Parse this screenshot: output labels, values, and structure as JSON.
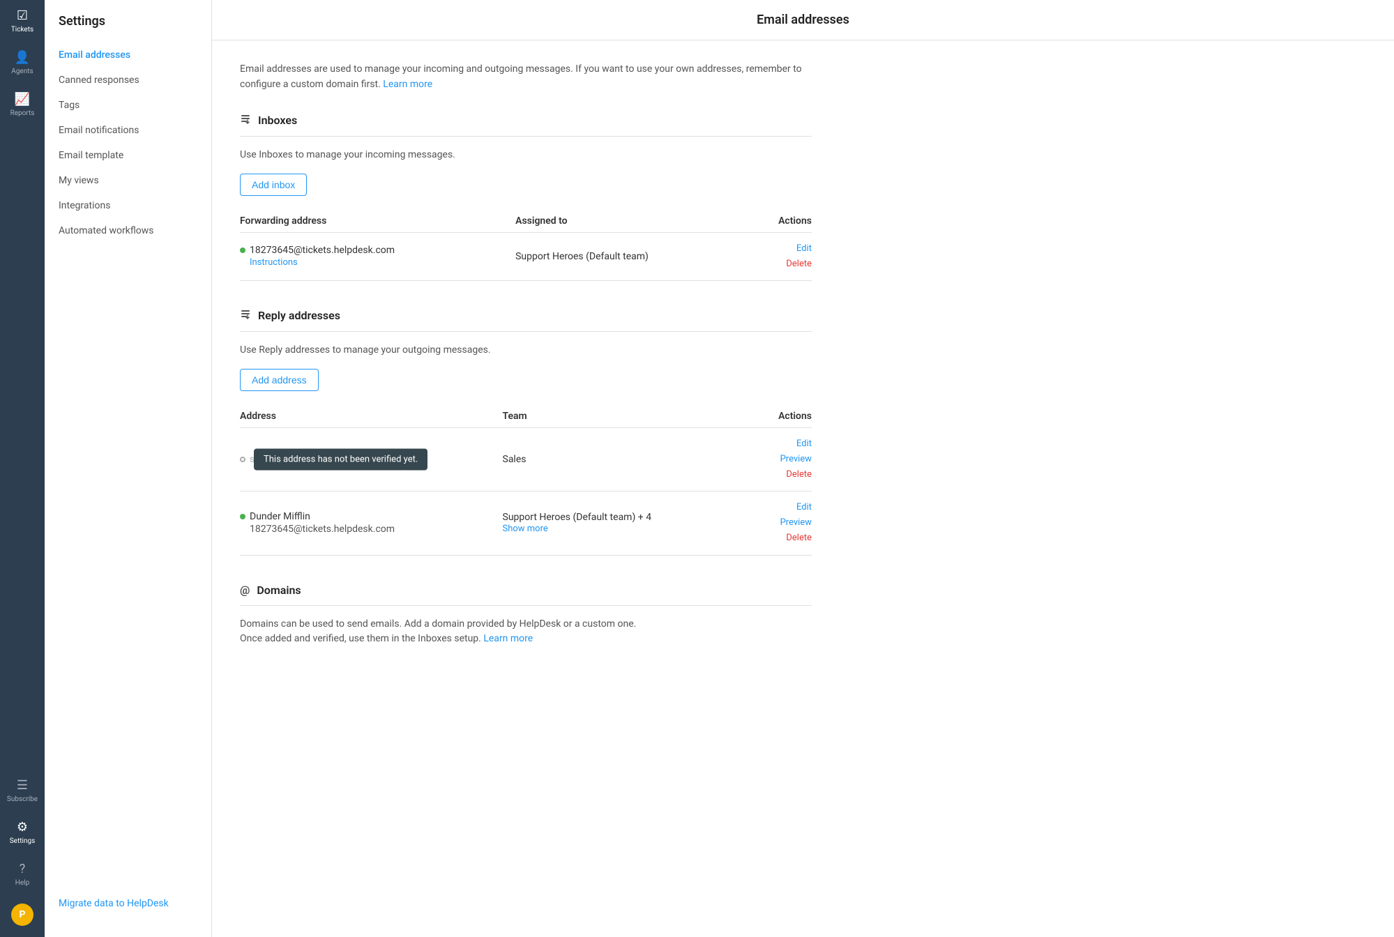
{
  "icon_nav": {
    "items": [
      {
        "id": "tickets",
        "label": "Tickets",
        "icon": "☑"
      },
      {
        "id": "agents",
        "label": "Agents",
        "icon": "👤"
      },
      {
        "id": "reports",
        "label": "Reports",
        "icon": "📈"
      }
    ],
    "bottom_items": [
      {
        "id": "subscribe",
        "label": "Subscribe",
        "icon": "☰"
      },
      {
        "id": "settings",
        "label": "Settings",
        "icon": "⚙"
      },
      {
        "id": "help",
        "label": "Help",
        "icon": "?"
      }
    ],
    "avatar_label": "P"
  },
  "sidebar": {
    "title": "Settings",
    "nav_items": [
      {
        "id": "email-addresses",
        "label": "Email addresses",
        "active": true
      },
      {
        "id": "canned-responses",
        "label": "Canned responses",
        "active": false
      },
      {
        "id": "tags",
        "label": "Tags",
        "active": false
      },
      {
        "id": "email-notifications",
        "label": "Email notifications",
        "active": false
      },
      {
        "id": "email-template",
        "label": "Email template",
        "active": false
      },
      {
        "id": "my-views",
        "label": "My views",
        "active": false
      },
      {
        "id": "integrations",
        "label": "Integrations",
        "active": false
      },
      {
        "id": "automated-workflows",
        "label": "Automated workflows",
        "active": false
      }
    ],
    "footer_link": "Migrate data to HelpDesk"
  },
  "main": {
    "header_title": "Email addresses",
    "description": "Email addresses are used to manage your incoming and outgoing messages. If you want to use your own addresses, remember to configure a custom domain first.",
    "learn_more_text": "Learn more",
    "inboxes": {
      "section_title": "Inboxes",
      "section_icon": "⬆",
      "divider": true,
      "description": "Use Inboxes to manage your incoming messages.",
      "add_button_label": "Add inbox",
      "columns": [
        {
          "key": "forwarding_address",
          "label": "Forwarding address"
        },
        {
          "key": "assigned_to",
          "label": "Assigned to"
        },
        {
          "key": "actions",
          "label": "Actions"
        }
      ],
      "rows": [
        {
          "id": "inbox-row-1",
          "status": "active",
          "forwarding_address": "18273645@tickets.helpdesk.com",
          "instructions_label": "Instructions",
          "assigned_to": "Support Heroes (Default team)",
          "actions": [
            "Edit",
            "Delete"
          ]
        }
      ]
    },
    "reply_addresses": {
      "section_title": "Reply addresses",
      "section_icon": "⬆",
      "description": "Use Reply addresses to manage your outgoing messages.",
      "add_button_label": "Add address",
      "columns": [
        {
          "key": "address",
          "label": "Address"
        },
        {
          "key": "team",
          "label": "Team"
        },
        {
          "key": "actions",
          "label": "Actions"
        }
      ],
      "rows": [
        {
          "id": "reply-row-1",
          "status": "unverified",
          "tooltip": "This address has not been verified yet.",
          "address": "sales@dundermifflin.com",
          "team": "Sales",
          "actions": [
            "Edit",
            "Preview",
            "Delete"
          ]
        },
        {
          "id": "reply-row-2",
          "status": "active",
          "name": "Dunder Mifflin",
          "address": "18273645@tickets.helpdesk.com",
          "team": "Support Heroes (Default team) + 4",
          "show_more_label": "Show more",
          "actions": [
            "Edit",
            "Preview",
            "Delete"
          ]
        }
      ]
    },
    "domains": {
      "section_title": "Domains",
      "section_icon": "@",
      "description": "Domains can be used to send emails. Add a domain provided by HelpDesk or a custom one.",
      "description2": "Once added and verified, use them in the Inboxes setup.",
      "learn_more_text": "Learn more"
    }
  }
}
